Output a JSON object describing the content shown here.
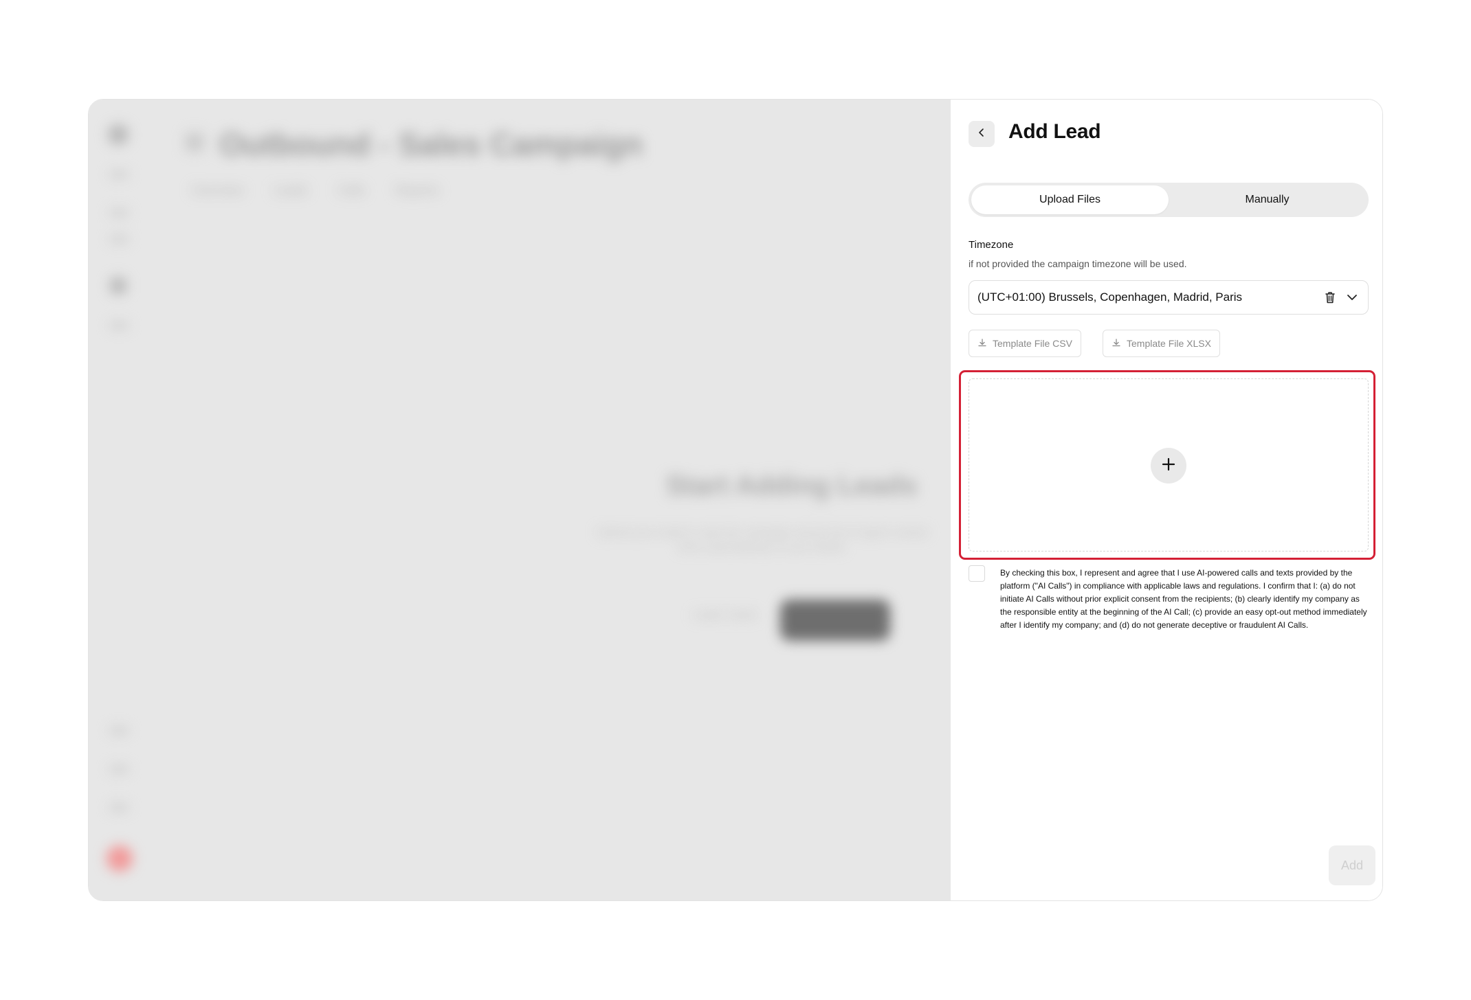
{
  "background_app": {
    "title": "Outbound - Sales Campaign",
    "tabs": [
      "Overview",
      "Leads",
      "Calls",
      "Reports"
    ],
    "empty_state": {
      "title": "Start Adding Leads",
      "text": "Upload your leads to start the campaign and let the AI agent contact them automatically on your behalf.",
      "secondary_button": "Learn more",
      "primary_button": "Add Lead"
    }
  },
  "panel": {
    "title": "Add Lead",
    "tabs": [
      {
        "label": "Upload Files",
        "active": true
      },
      {
        "label": "Manually",
        "active": false
      }
    ],
    "timezone": {
      "label": "Timezone",
      "help": "if not provided the campaign timezone will be used.",
      "value": "(UTC+01:00) Brussels, Copenhagen, Madrid, Paris"
    },
    "template_buttons": {
      "csv": "Template File CSV",
      "xlsx": "Template File XLSX"
    },
    "consent": {
      "checked": false,
      "text": "By checking this box, I represent and agree that I use AI-powered calls and texts provided by the platform (\"AI Calls\") in compliance with applicable laws and regulations. I confirm that I: (a) do not initiate AI Calls without prior explicit consent from the recipients; (b) clearly identify my company as the responsible entity at the beginning of the AI Call; (c) provide an easy opt-out method immediately after I identify my company; and (d) do not generate deceptive or fraudulent AI Calls."
    },
    "add_button": "Add"
  },
  "icons": {
    "back": "chevron-left-icon",
    "delete": "trash-icon",
    "dropdown": "chevron-down-icon",
    "download": "download-icon",
    "upload": "plus-icon"
  },
  "colors": {
    "highlight": "#d42035",
    "overlay": "#e7e7e7",
    "accent_red": "#f19a9a"
  }
}
